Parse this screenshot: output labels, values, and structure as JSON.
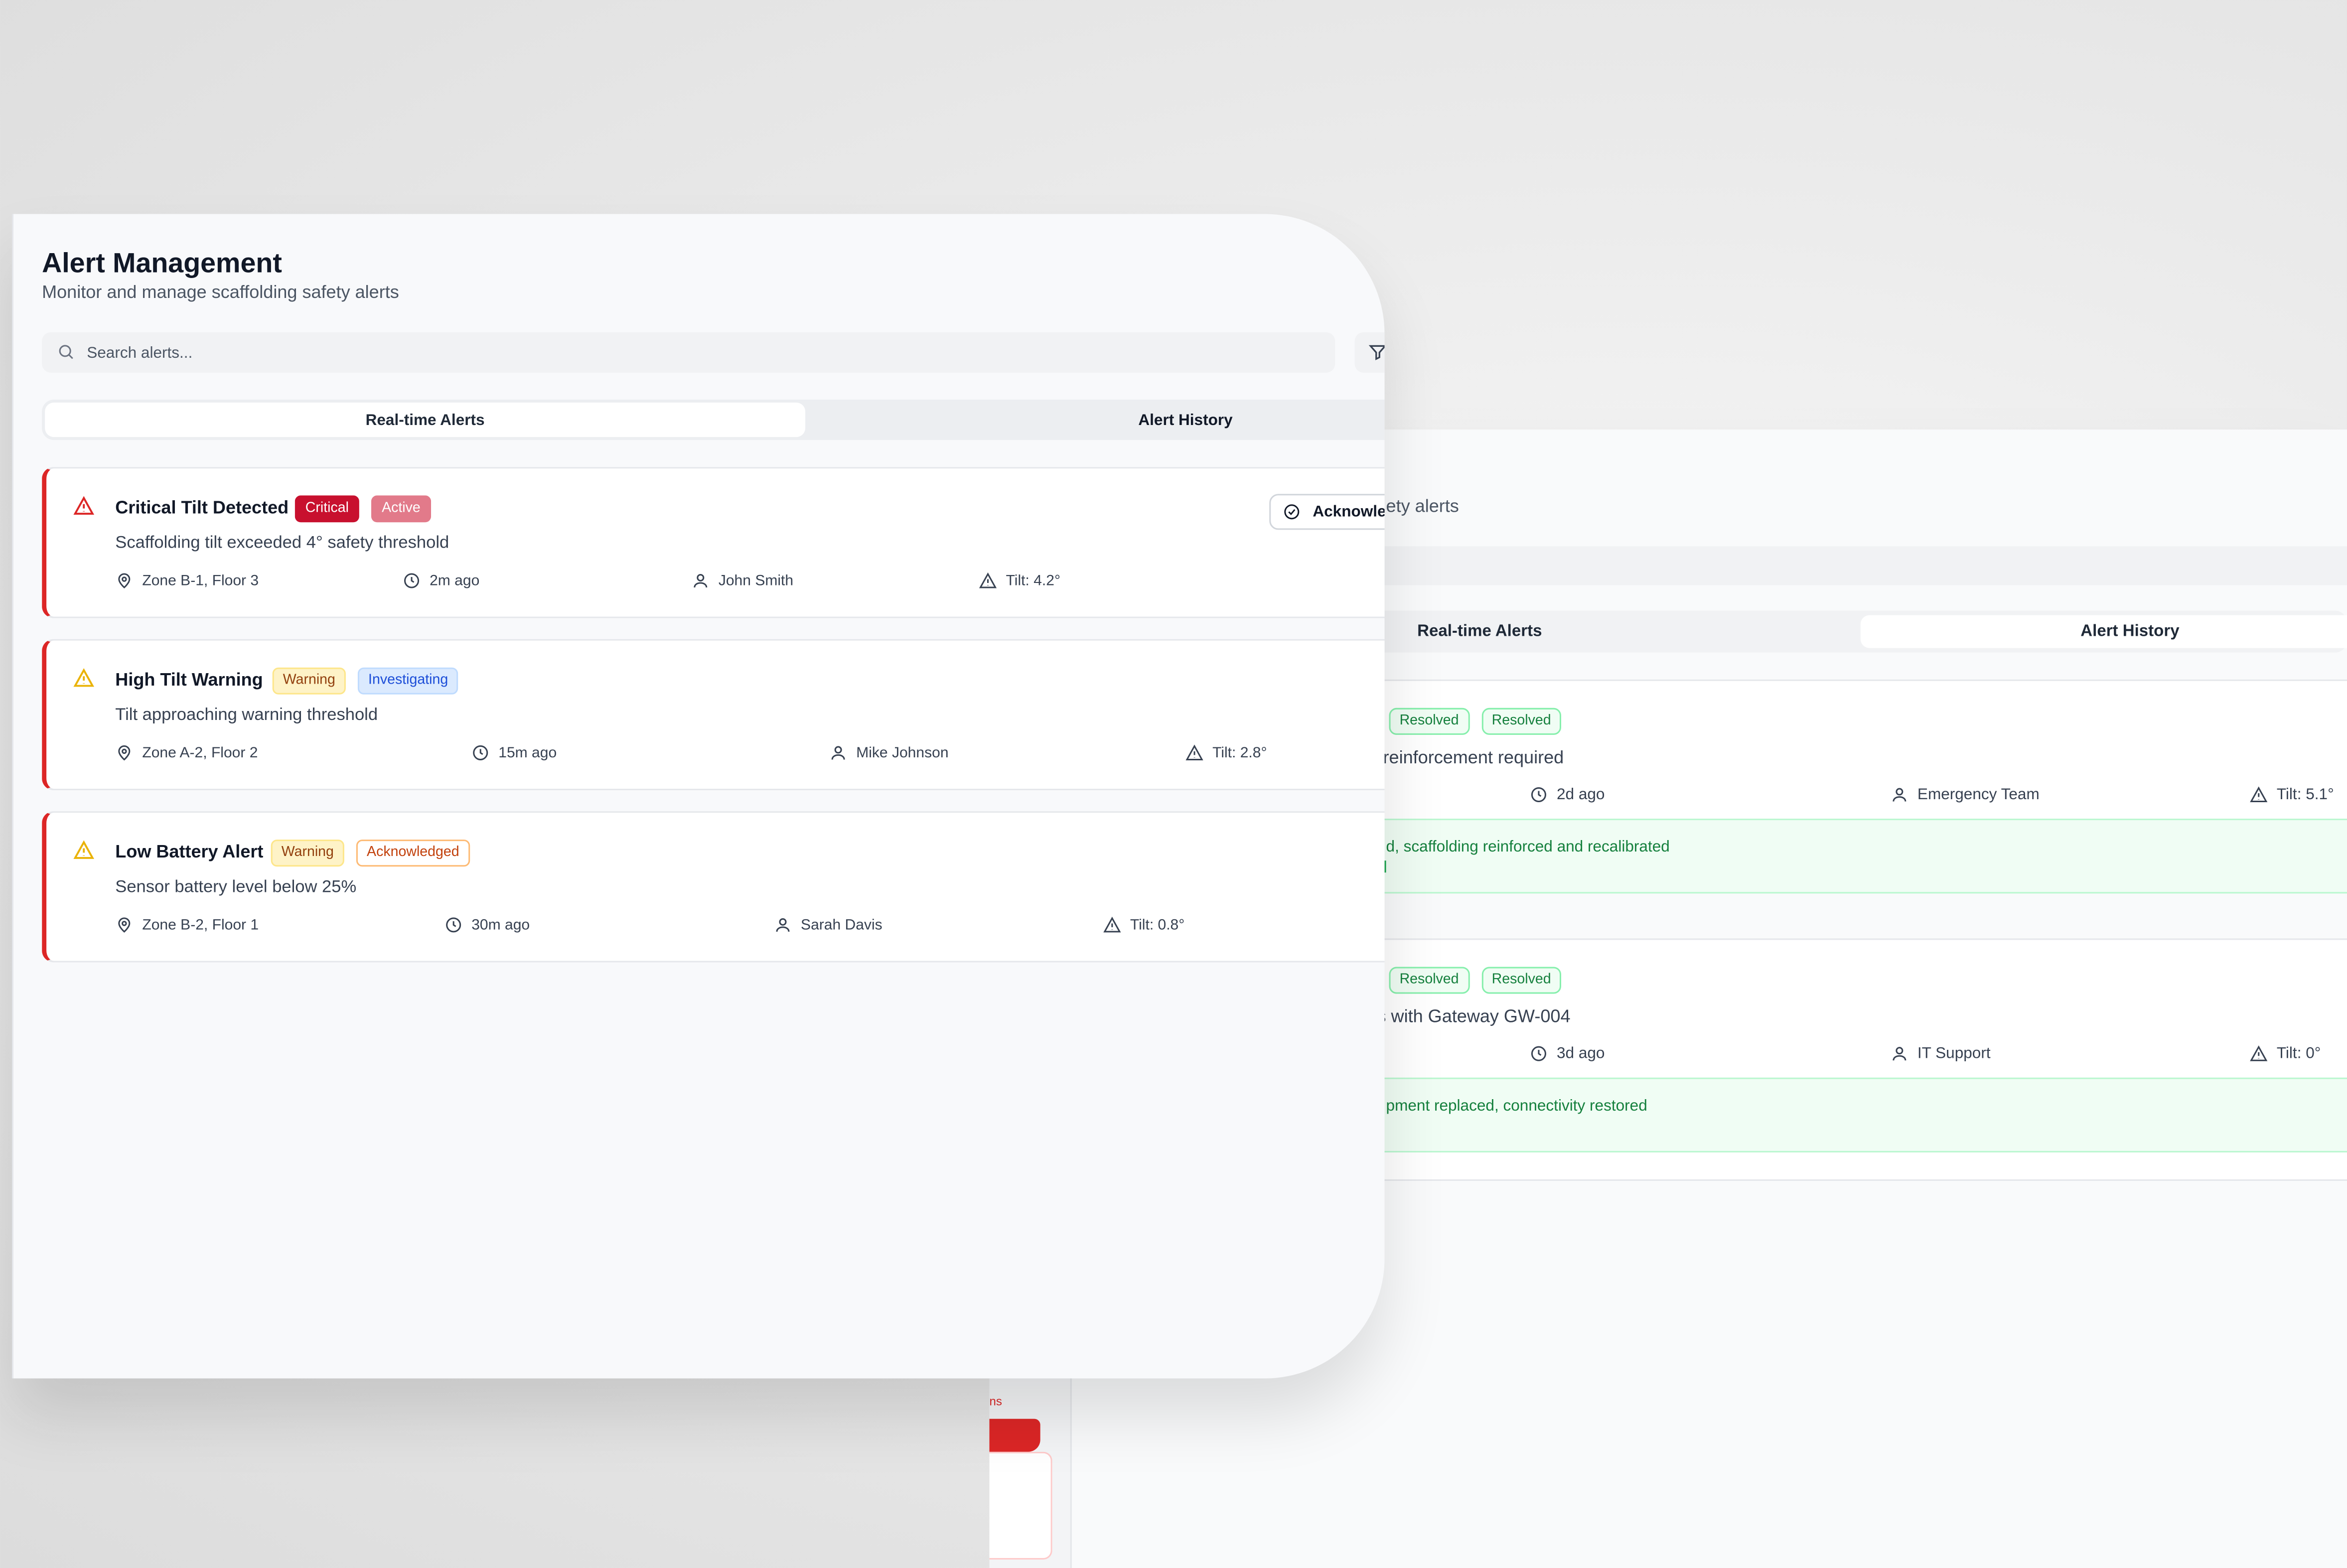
{
  "history_panel": {
    "subtitle_fragment": "ety alerts",
    "tabs": [
      "Real-time Alerts",
      "Alert History"
    ],
    "alerts": [
      {
        "status": "Resolved",
        "state": "Resolved",
        "description": "reinforcement required",
        "time": "2d ago",
        "assignee": "Emergency Team",
        "tilt": "Tilt: 5.1°",
        "resolution": "d, scaffolding reinforced and recalibrated"
      },
      {
        "status": "Resolved",
        "state": "Resolved",
        "description": "s with Gateway GW-004",
        "time": "3d ago",
        "assignee": "IT Support",
        "tilt": "Tilt: 0°",
        "resolution": "pment replaced, connectivity restored"
      }
    ]
  },
  "sliver": {
    "text": "ns"
  },
  "main": {
    "title": "Alert Management",
    "subtitle": "Monitor and manage scaffolding safety alerts",
    "search_placeholder": "Search alerts...",
    "tabs": {
      "realtime": "Real-time Alerts",
      "history": "Alert History"
    },
    "acknowledge_label": "Acknowledge",
    "alerts": [
      {
        "title": "Critical Tilt Detected",
        "severity": "Critical",
        "status": "Active",
        "description": "Scaffolding tilt exceeded 4° safety threshold",
        "location": "Zone B-1, Floor 3",
        "time": "2m ago",
        "assignee": "John Smith",
        "tilt": "Tilt: 4.2°"
      },
      {
        "title": "High Tilt Warning",
        "severity": "Warning",
        "status": "Investigating",
        "description": "Tilt approaching warning threshold",
        "location": "Zone A-2, Floor 2",
        "time": "15m ago",
        "assignee": "Mike Johnson",
        "tilt": "Tilt: 2.8°"
      },
      {
        "title": "Low Battery Alert",
        "severity": "Warning",
        "status": "Acknowledged",
        "description": "Sensor battery level below 25%",
        "location": "Zone B-2, Floor 1",
        "time": "30m ago",
        "assignee": "Sarah Davis",
        "tilt": "Tilt: 0.8°"
      }
    ]
  },
  "colors": {
    "critical": "#c8102e",
    "warning_icon": "#eab308",
    "accent_border": "#dc2626",
    "resolved": "#15803d"
  }
}
